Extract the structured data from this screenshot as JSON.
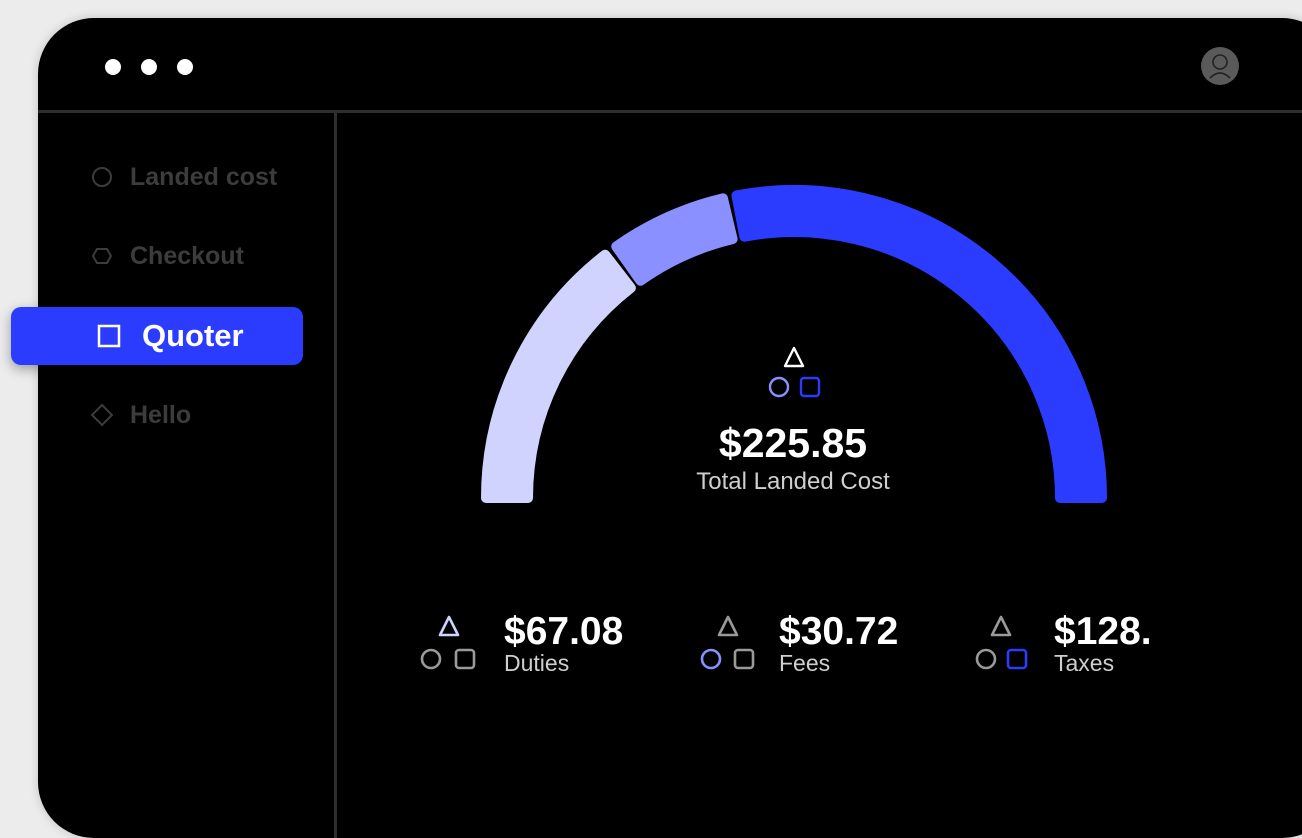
{
  "window": {
    "controls": [
      "dot",
      "dot",
      "dot"
    ]
  },
  "sidebar": {
    "items": [
      {
        "label": "Landed cost",
        "icon": "circle-icon",
        "active": false
      },
      {
        "label": "Checkout",
        "icon": "hexagon-icon",
        "active": false
      },
      {
        "label": "Quoter",
        "icon": "square-icon",
        "active": true
      },
      {
        "label": "Hello",
        "icon": "diamond-icon",
        "active": false
      }
    ]
  },
  "total": {
    "amount": "$225.85",
    "label": "Total  Landed Cost"
  },
  "stats": [
    {
      "amount": "$67.08",
      "label": "Duties",
      "highlight": "triangle"
    },
    {
      "amount": "$30.72",
      "label": "Fees",
      "highlight": "circle"
    },
    {
      "amount": "$128.",
      "label": "Taxes",
      "highlight": "square"
    }
  ],
  "gauge": {
    "segments": [
      {
        "name": "Duties",
        "value": 67.08,
        "color": "#d1d3ff"
      },
      {
        "name": "Fees",
        "value": 30.72,
        "color": "#8a90ff"
      },
      {
        "name": "Taxes",
        "value": 128.05,
        "color": "#2b3cff"
      }
    ]
  },
  "colors": {
    "accent": "#2b3cff",
    "accent_mid": "#8a90ff",
    "accent_light": "#d1d3ff",
    "muted": "#3c3c3c",
    "icon_muted": "#9a9a9a"
  }
}
